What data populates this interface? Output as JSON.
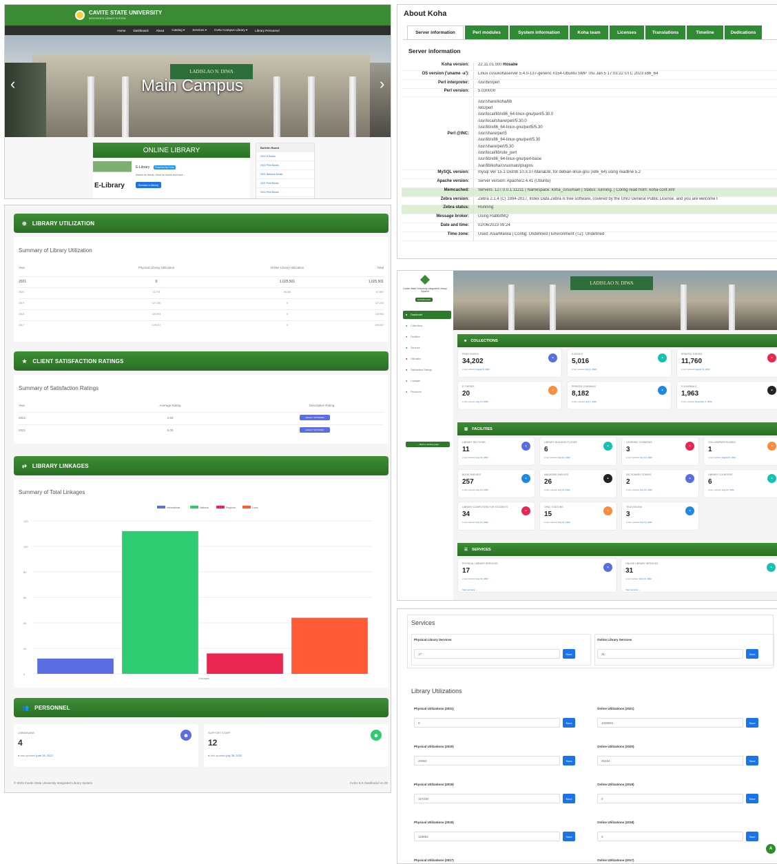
{
  "site": {
    "title": "CAVITE STATE UNIVERSITY",
    "subtitle": "INTEGRATED LIBRARY SYSTEM",
    "nav": [
      "Home",
      "Dashboard",
      "About",
      "Catalog ▾",
      "Services ▾",
      "CvSU Campus Library ▾",
      "Library Personnel"
    ],
    "hero_text": "Main Campus",
    "online_library": "ONLINE LIBRARY",
    "elib_logo": "E-Library",
    "elib_title": "E-Library",
    "elib_badge": "Powered by Koha",
    "elib_desc": "Search for thesis, check for books and more...",
    "browse_button": "Browse e-library",
    "bulletin_title": "Bulletin Board",
    "bulletin_items": [
      "2022 E-Books",
      "2022 Print Books",
      "2021 Network Books",
      "2021 Print Books",
      "2022 Print Books"
    ]
  },
  "dashboard": {
    "utilization_header": "LIBRARY UTILIZATION",
    "utilization_summary": "Summary of Library Utilization",
    "util_columns": [
      "Year",
      "Physical Library Utilization",
      "Online Library Utilization",
      "Total"
    ],
    "util_rows": [
      [
        "2021",
        "0",
        "1,025,501",
        "1,025,501"
      ],
      [
        "2020",
        "22,703",
        "45,154",
        "67,857"
      ],
      [
        "2019",
        "127,230",
        "0",
        "127,230"
      ],
      [
        "2018",
        "119,953",
        "0",
        "119,953"
      ],
      [
        "2017",
        "109,047",
        "0",
        "109,047"
      ]
    ],
    "satisfaction_header": "CLIENT SATISFACTION RATINGS",
    "satisfaction_summary": "Summary of Satisfaction Ratings",
    "sat_columns": [
      "Year",
      "Average Rating",
      "Descriptive Rating"
    ],
    "sat_rows": [
      [
        "2022",
        "4.59",
        "HIGHLY SATISFIED"
      ],
      [
        "2021",
        "5.00",
        "HIGHLY SATISFIED"
      ]
    ],
    "linkages_header": "LIBRARY LINKAGES",
    "linkages_summary": "Summary of Total Linkages",
    "personnel_header": "PERSONNEL",
    "librarians_label": "LIBRARIANS",
    "librarians_value": "4",
    "librarians_updated_prefix": "last updated",
    "librarians_updated_date": "june 28, 2022",
    "staff_label": "SUPPORT STAFF",
    "staff_value": "12",
    "staff_updated_prefix": "last updated",
    "staff_updated_date": "july 28, 2022",
    "footer_left": "© 2023 Cavite State University Integrated Library System",
    "footer_right": "CvSU ILS Dashboard v1.00"
  },
  "chart_data": {
    "type": "bar",
    "title": "",
    "xlabel": "Linkages",
    "categories": [
      "Linkages"
    ],
    "series": [
      {
        "name": "International",
        "values": [
          12
        ],
        "color": "#5b6ee1"
      },
      {
        "name": "National",
        "values": [
          112
        ],
        "color": "#2ecc71"
      },
      {
        "name": "Regional",
        "values": [
          16
        ],
        "color": "#e8264f"
      },
      {
        "name": "Local",
        "values": [
          44
        ],
        "color": "#ff5a36"
      }
    ],
    "ylim": [
      0,
      120
    ],
    "yticks": [
      "0",
      "20",
      "40",
      "60",
      "80",
      "100",
      "120"
    ],
    "legend": "top"
  },
  "koha": {
    "title": "About Koha",
    "tabs": [
      "Server information",
      "Perl modules",
      "System information",
      "Koha team",
      "Licenses",
      "Translations",
      "Timeline",
      "Dedications"
    ],
    "section": "Server information",
    "rows": [
      {
        "k": "Koha version:",
        "v": "22.11.01.000 ",
        "b": "Rosalie"
      },
      {
        "k": "OS version ('uname -a'):",
        "v": "Linux cvsukohaserver 5.4.0-137-generic #154-Ubuntu SMP Thu Jan 5 17:03:22 UTC 2023 x86_64"
      },
      {
        "k": "Perl interpreter:",
        "v": "/usr/bin/perl"
      },
      {
        "k": "Perl version:",
        "v": "5.030000"
      }
    ],
    "perl_inc_label": "Perl @INC:",
    "perl_inc": [
      "/usr/share/koha/lib",
      "/etc/perl",
      "/usr/local/lib/x86_64-linux-gnu/perl/5.30.0",
      "/usr/local/share/perl/5.30.0",
      "/usr/lib/x86_64-linux-gnu/perl5/5.30",
      "/usr/share/perl5",
      "/usr/lib/x86_64-linux-gnu/perl/5.30",
      "/usr/share/perl/5.30",
      "/usr/local/lib/site_perl",
      "/usr/lib/x86_64-linux-gnu/perl-base",
      "/var/lib/koha/cvsumain/plugins"
    ],
    "rows2": [
      {
        "k": "MySQL version:",
        "v": "mysql Ver 15.1 Distrib 10.3.37-MariaDB, for debian-linux-gnu (x86_64) using readline 5.2",
        "g": false
      },
      {
        "k": "Apache version:",
        "v": "Server version: Apache/2.4.41 (Ubuntu)",
        "g": false
      },
      {
        "k": "Memcached:",
        "v": "Servers: 127.0.0.1:11211 | Namespace: koha_cvsumain | Status: running. | Config read from: koha-conf.xml",
        "g": true
      },
      {
        "k": "Zebra version:",
        "v": "Zebra 2.1.4 (C) 1994-2017, Index Data Zebra is free software, covered by the GNU General Public License, and you are welcome t",
        "g": false
      },
      {
        "k": "Zebra status:",
        "v": "Running",
        "g": true
      },
      {
        "k": "Message broker:",
        "v": "Using RabbitMQ",
        "g": false
      },
      {
        "k": "Date and time:",
        "v": "02/06/2023 09:24",
        "g": false
      },
      {
        "k": "Time zone:",
        "v": "Used: Asia/Manila | Config: Undefined | Environment (TZ): Undefined",
        "g": false
      }
    ]
  },
  "admin": {
    "brand": "Cavite State University Integrated Library System",
    "brand_badge": "DASHBOARD",
    "menu": [
      "Dashboard",
      "Collections",
      "Facilities",
      "Services",
      "Utilization",
      "Satisfaction Ratings",
      "Linkages",
      "Personnel"
    ],
    "back_button": "← Back to landing page",
    "collections_header": "COLLECTIONS",
    "facilities_header": "FACILITIES",
    "services_header": "SERVICES",
    "updated_prefix": "last updated",
    "collections": [
      {
        "label": "PRINT BOOKS",
        "value": "34,202",
        "date": "August 8, 2022",
        "color": "#5b6ee1",
        "icon": "▪"
      },
      {
        "label": "E-BOOKS",
        "value": "5,016",
        "date": "July 1, 2022",
        "color": "#17c1b0",
        "icon": "▪"
      },
      {
        "label": "PRINTED THESES",
        "value": "11,760",
        "date": "August 12, 2022",
        "color": "#e8264f",
        "icon": "▪"
      },
      {
        "label": "E-THESES",
        "value": "20",
        "date": "July 13, 2022",
        "color": "#fb8c3a",
        "icon": "▪"
      },
      {
        "label": "PRINTED JOURNALS",
        "value": "8,182",
        "date": "July 1, 2022",
        "color": "#1e88e5",
        "icon": "▪"
      },
      {
        "label": "E-JOURNALS",
        "value": "1,963",
        "date": "November 1, 2022",
        "color": "#222222",
        "icon": "▪"
      }
    ],
    "facilities": [
      {
        "label": "LIBRARY SECTIONS",
        "value": "11",
        "date": "July 14, 2022",
        "color": "#5b6ee1"
      },
      {
        "label": "LIBRARY BUILDING FLOORS",
        "value": "6",
        "date": "July 14, 2022",
        "color": "#17c1b0"
      },
      {
        "label": "LEARNING COMMONS",
        "value": "3",
        "date": "July 14, 2022",
        "color": "#e8264f"
      },
      {
        "label": "COLLABORATION AREA",
        "value": "1",
        "date": "August 8, 2022",
        "color": "#fb8c3a"
      },
      {
        "label": "BOOK SHELVES",
        "value": "257",
        "date": "July 14, 2022",
        "color": "#1e88e5"
      },
      {
        "label": "MAGAZINE SHELVES",
        "value": "26",
        "date": "July 14, 2022",
        "color": "#222222"
      },
      {
        "label": "DICTIONARY STANDS",
        "value": "2",
        "date": "July 14, 2022",
        "color": "#5b6ee1"
      },
      {
        "label": "LIBRARY COUNTERS",
        "value": "6",
        "date": "July 14, 2022",
        "color": "#17c1b0"
      },
      {
        "label": "LIBRARY COMPUTERS FOR STUDENTS",
        "value": "34",
        "date": "July 14, 2022",
        "color": "#e8264f"
      },
      {
        "label": "OPAC STATIONS",
        "value": "15",
        "date": "July 14, 2022",
        "color": "#fb8c3a"
      },
      {
        "label": "TELEVISIONS",
        "value": "3",
        "date": "July 14, 2022",
        "color": "#1e88e5"
      }
    ],
    "services": [
      {
        "label": "PHYSICAL LIBRARY SERVICES",
        "value": "17",
        "date": "July 14, 2022",
        "color": "#5b6ee1"
      },
      {
        "label": "ONLINE LIBRARY SERVICES",
        "value": "31",
        "date": "July 14, 2022",
        "color": "#17c1b0"
      }
    ],
    "view_services": "View services →"
  },
  "forms": {
    "services_title": "Services",
    "phys_services_label": "Physical Library Services",
    "phys_services_value": "17",
    "online_services_label": "Online Library Services",
    "online_services_value": "31",
    "save": "Save",
    "util_title": "Library Utilizations",
    "util": [
      {
        "pl": "Physical Utilizations (2021)",
        "pv": "0",
        "ol": "Online Utilizations (2021)",
        "ov": "1025501"
      },
      {
        "pl": "Physical Utilizations (2020)",
        "pv": "22063",
        "ol": "Online Utilizations (2020)",
        "ov": "45154"
      },
      {
        "pl": "Physical Utilizations (2019)",
        "pv": "127230",
        "ol": "Online Utilizations (2019)",
        "ov": "0"
      },
      {
        "pl": "Physical Utilizations (2018)",
        "pv": "119953",
        "ol": "Online Utilizations (2018)",
        "ov": "0"
      }
    ],
    "util_2017_p": "Physical Utilizations (2017)",
    "util_2017_o": "Online Utilizations (2017)",
    "fab": "A"
  }
}
